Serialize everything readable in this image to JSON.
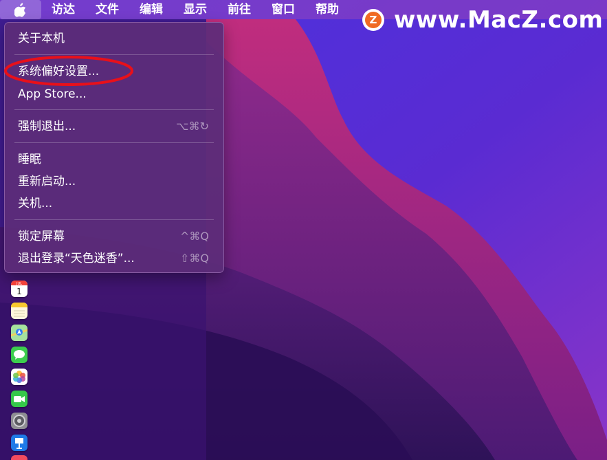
{
  "menubar": {
    "apple_icon": "apple-logo-icon",
    "items": [
      {
        "label": "访达"
      },
      {
        "label": "文件"
      },
      {
        "label": "编辑"
      },
      {
        "label": "显示"
      },
      {
        "label": "前往"
      },
      {
        "label": "窗口"
      },
      {
        "label": "帮助"
      }
    ]
  },
  "watermark": {
    "badge": "Z",
    "text": "www.MacZ.com"
  },
  "apple_menu": {
    "items": [
      {
        "label": "关于本机",
        "shortcut": ""
      },
      {
        "label": "系统偏好设置...",
        "shortcut": "",
        "highlighted": true
      },
      {
        "label": "App Store...",
        "shortcut": ""
      },
      {
        "label": "强制退出...",
        "shortcut": "⌥⌘↻"
      },
      {
        "label": "睡眠",
        "shortcut": ""
      },
      {
        "label": "重新启动...",
        "shortcut": ""
      },
      {
        "label": "关机...",
        "shortcut": ""
      },
      {
        "label": "锁定屏幕",
        "shortcut": "^⌘Q"
      },
      {
        "label": "退出登录“天色迷香”...",
        "shortcut": "⇧⌘Q"
      }
    ],
    "highlight_color": "#e8101a"
  },
  "dock": {
    "icons": [
      "calendar-icon",
      "notes-icon",
      "maps-icon",
      "messages-icon",
      "photos-icon",
      "facetime-icon",
      "system-preferences-icon",
      "keynote-icon",
      "music-icon"
    ],
    "calendar_day": "1",
    "calendar_month_label": "JUL"
  },
  "colors": {
    "wallpaper_dark": "#2a0d55",
    "wallpaper_magenta": "#b5257e",
    "wallpaper_blue": "#3a2bd0",
    "menu_background": "#5c2c78"
  }
}
